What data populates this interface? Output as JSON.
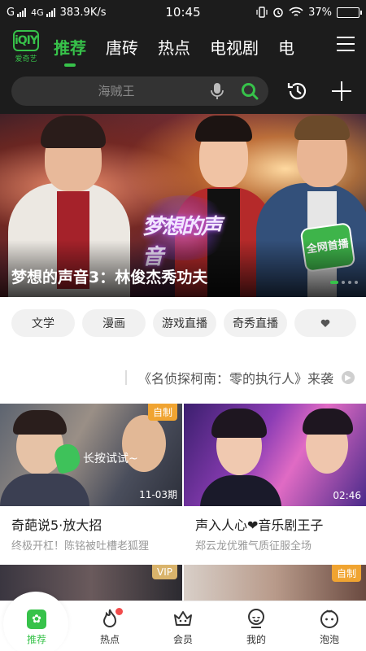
{
  "status": {
    "carrier": "G",
    "network": "4G",
    "speed": "383.9K/s",
    "time": "10:45",
    "battery": "37%",
    "battery_level": 0.37
  },
  "app": {
    "logo_mark": "iQIY",
    "logo_text": "爱奇艺"
  },
  "tabs": [
    {
      "label": "推荐"
    },
    {
      "label": "唐砖"
    },
    {
      "label": "热点"
    },
    {
      "label": "电视剧"
    },
    {
      "label": "电"
    }
  ],
  "search": {
    "placeholder": "海贼王"
  },
  "banner": {
    "title": "梦想的声音3：林俊杰秀功夫",
    "show_logo": "梦想的声音",
    "badge": "全网首播"
  },
  "chips": [
    {
      "label": "文学"
    },
    {
      "label": "漫画"
    },
    {
      "label": "游戏直播"
    },
    {
      "label": "奇秀直播"
    }
  ],
  "notice": {
    "text": "《名侦探柯南：零的执行人》来袭"
  },
  "cards": [
    {
      "title": "奇葩说5·放大招",
      "sub": "终极开杠！陈铭被吐槽老狐狸",
      "badge": "自制",
      "meta": "11-03期",
      "hint": "长按试试~"
    },
    {
      "title": "声入人心❤音乐剧王子",
      "sub": "郑云龙优雅气质征服全场",
      "duration": "02:46"
    },
    {
      "badge": "VIP"
    },
    {
      "badge": "自制"
    }
  ],
  "bottom_nav": [
    {
      "label": "推荐"
    },
    {
      "label": "热点"
    },
    {
      "label": "会员"
    },
    {
      "label": "我的"
    },
    {
      "label": "泡泡"
    }
  ],
  "colors": {
    "accent": "#37c24a",
    "header_bg": "#1c1c1c",
    "badge_orange": "#f0a431",
    "notify_red": "#f24b4b"
  }
}
